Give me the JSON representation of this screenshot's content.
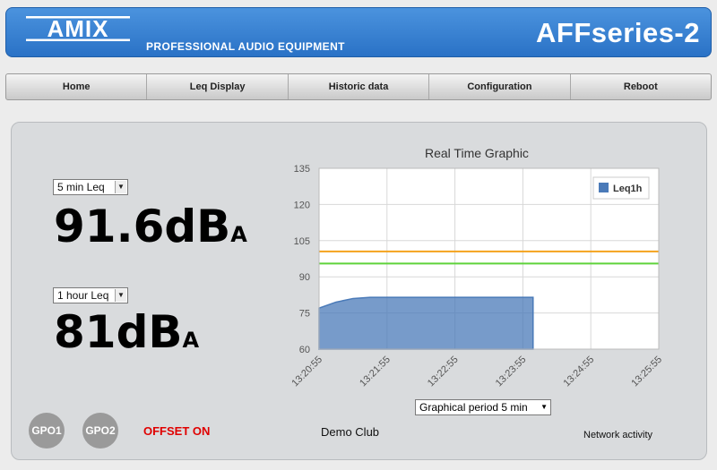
{
  "header": {
    "logo_text": "AMIX",
    "tagline": "PROFESSIONAL AUDIO EQUIPMENT",
    "device_name": "AFFseries-2",
    "colors": {
      "header_bg": "#3381d2",
      "header_text": "#ffffff"
    }
  },
  "nav": {
    "items": [
      {
        "label": "Home"
      },
      {
        "label": "Leq Display"
      },
      {
        "label": "Historic data"
      },
      {
        "label": "Configuration"
      },
      {
        "label": "Reboot"
      }
    ]
  },
  "meters": {
    "primary": {
      "period": "5 min Leq",
      "value": "91.6dB",
      "unit_sub": "A"
    },
    "secondary": {
      "period": "1 hour Leq",
      "value": "81dB",
      "unit_sub": "A"
    }
  },
  "status": {
    "gpo1": "GPO1",
    "gpo2": "GPO2",
    "offset": "OFFSET ON",
    "club_name": "Demo Club",
    "network": "Network activity",
    "offset_color": "#e00000"
  },
  "chart_data": {
    "type": "area",
    "title": "Real Time Graphic",
    "xlabel": "",
    "ylabel": "",
    "ylim": [
      60,
      135
    ],
    "y_ticks": [
      "135",
      "120",
      "105",
      "90",
      "75",
      "60"
    ],
    "x_ticks": [
      "13:20:55",
      "13:21:55",
      "13:22:55",
      "13:23:55",
      "13:24:55",
      "13:25:55"
    ],
    "grid": true,
    "legend_position": "top-right",
    "series": [
      {
        "name": "Leq1h",
        "color": "#4a7ab8",
        "x": [
          "13:20:55",
          "13:21:10",
          "13:21:25",
          "13:21:40",
          "13:22:00",
          "13:22:30",
          "13:23:00",
          "13:23:30",
          "13:24:04"
        ],
        "values": [
          77,
          79.5,
          81,
          81.5,
          81.5,
          81.5,
          81.5,
          81.5,
          81.5
        ]
      }
    ],
    "threshold_lines": [
      {
        "value": 100.5,
        "color": "#f4a21d"
      },
      {
        "value": 95.5,
        "color": "#5fd33b"
      }
    ]
  },
  "period_select": {
    "label": "Graphical period 5 min"
  }
}
